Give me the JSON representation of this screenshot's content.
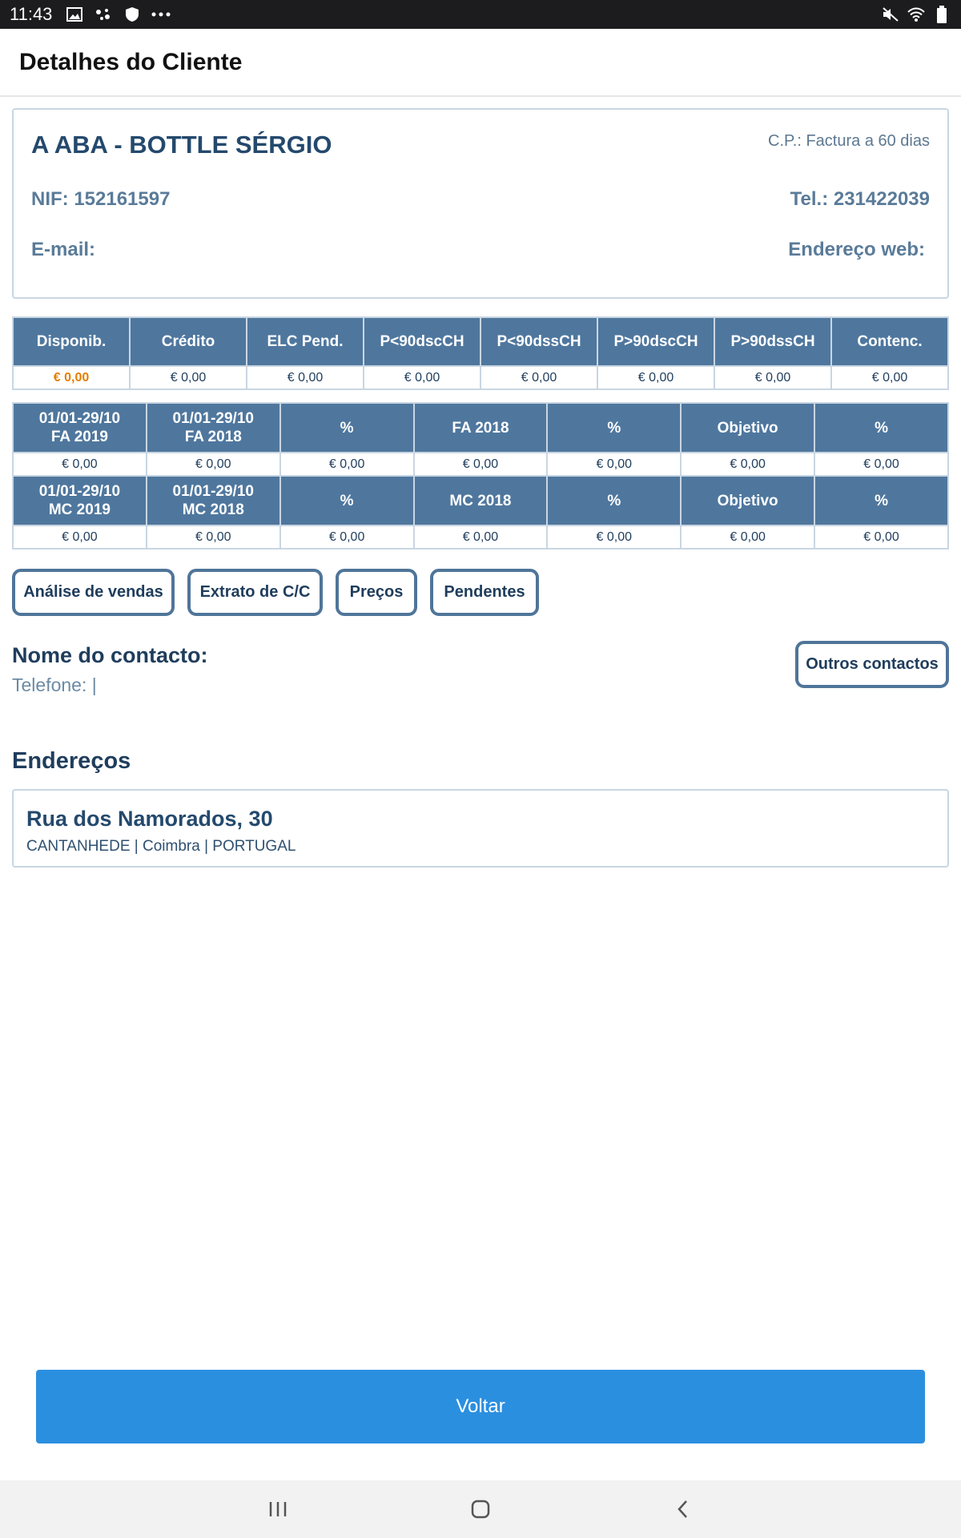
{
  "status_bar": {
    "time": "11:43",
    "left_icons": [
      "image-icon",
      "assistant-icon",
      "shield-icon",
      "more-dots-icon"
    ],
    "right_icons": [
      "mute-icon",
      "wifi-icon",
      "battery-icon"
    ]
  },
  "app_bar": {
    "title": "Detalhes do Cliente"
  },
  "client": {
    "name": "A ABA - BOTTLE SÉRGIO",
    "payment_terms": "C.P.: Factura a 60 dias",
    "nif": "NIF: 152161597",
    "tel": "Tel.: 231422039",
    "email_label": "E-mail:",
    "web_label": "Endereço web:"
  },
  "balance_table": {
    "headers": [
      "Disponib.",
      "Crédito",
      "ELC Pend.",
      "P<90dscCH",
      "P<90dssCH",
      "P>90dscCH",
      "P>90dssCH",
      "Contenc."
    ],
    "values": [
      "€ 0,00",
      "€ 0,00",
      "€ 0,00",
      "€ 0,00",
      "€ 0,00",
      "€ 0,00",
      "€ 0,00",
      "€ 0,00"
    ],
    "highlight_color": "#e57e00"
  },
  "sales_table": {
    "fa_headers": [
      [
        "01/01-29/10",
        "FA 2019"
      ],
      [
        "01/01-29/10",
        "FA 2018"
      ],
      [
        "%"
      ],
      [
        "FA 2018"
      ],
      [
        "%"
      ],
      [
        "Objetivo"
      ],
      [
        "%"
      ]
    ],
    "fa_values": [
      "€ 0,00",
      "€ 0,00",
      "€ 0,00",
      "€ 0,00",
      "€ 0,00",
      "€ 0,00",
      "€ 0,00"
    ],
    "mc_headers": [
      [
        "01/01-29/10",
        "MC 2019"
      ],
      [
        "01/01-29/10",
        "MC 2018"
      ],
      [
        "%"
      ],
      [
        "MC 2018"
      ],
      [
        "%"
      ],
      [
        "Objetivo"
      ],
      [
        "%"
      ]
    ],
    "mc_values": [
      "€ 0,00",
      "€ 0,00",
      "€ 0,00",
      "€ 0,00",
      "€ 0,00",
      "€ 0,00",
      "€ 0,00"
    ]
  },
  "actions": {
    "sales_analysis": "Análise de vendas",
    "account_statement": "Extrato de C/C",
    "prices": "Preços",
    "pending": "Pendentes"
  },
  "contact": {
    "name_label": "Nome do contacto:",
    "phone": "Telefone:  |",
    "other_contacts": "Outros contactos"
  },
  "addresses": {
    "title": "Endereços",
    "items": [
      {
        "street": "Rua dos Namorados, 30",
        "city": "CANTANHEDE | Coimbra | PORTUGAL"
      }
    ]
  },
  "back_button": "Voltar",
  "colors": {
    "header_bg": "#4f779e",
    "border": "#c9d6e2",
    "primary_button": "#2b8fe0",
    "text_dark": "#1f3d5c"
  }
}
